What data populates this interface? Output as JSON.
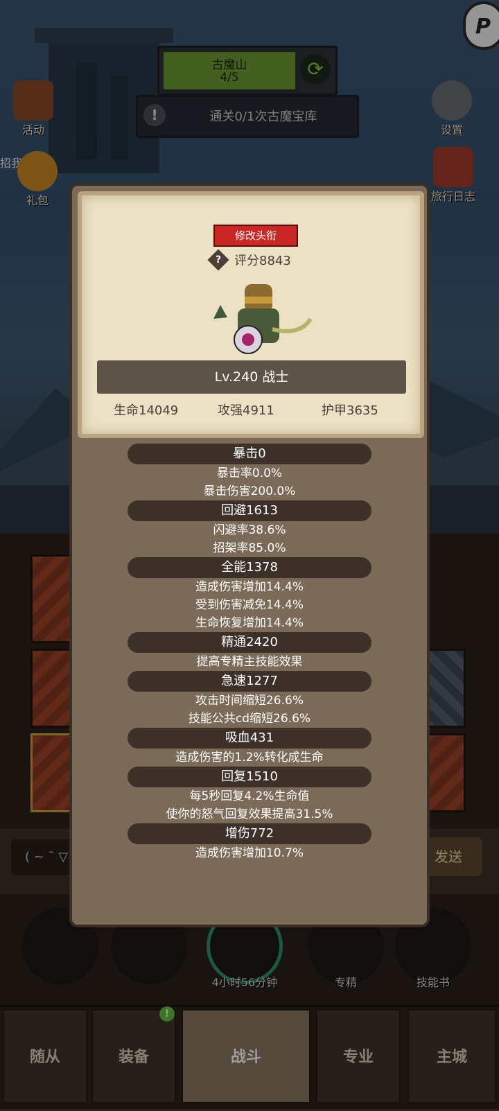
{
  "scene": {
    "dungeon": {
      "name": "古魔山",
      "progress": "4/5"
    },
    "quest": {
      "text": "通关0/1次古魔宝库"
    },
    "left_menu": [
      {
        "label": "活动"
      },
      {
        "label": "礼包"
      }
    ],
    "left_fragment": "招我g",
    "right_menu": [
      {
        "label": "设置"
      },
      {
        "label": "旅行日志"
      }
    ],
    "corner_letter": "P",
    "chat": {
      "input_text": "( ~ ¯ ▽",
      "send_label": "发送"
    },
    "skills": [
      {
        "label": ""
      },
      {
        "label": ""
      },
      {
        "label": "4小时56分钟"
      },
      {
        "label": "专精"
      },
      {
        "label": "技能书"
      }
    ],
    "nav": [
      {
        "label": "随从"
      },
      {
        "label": "装备"
      },
      {
        "label": "战斗"
      },
      {
        "label": "专业"
      },
      {
        "label": "主城"
      }
    ],
    "nav_badge": "!"
  },
  "modal": {
    "modify_title_label": "修改头衔",
    "score_label": "评分8843",
    "help_glyph": "?",
    "name_banner": "Lv.240 战士",
    "main_stats": [
      "生命14049",
      "攻强4911",
      "护甲3635"
    ],
    "stats": [
      {
        "header": "暴击0",
        "lines": [
          "暴击率0.0%",
          "暴击伤害200.0%"
        ]
      },
      {
        "header": "回避1613",
        "lines": [
          "闪避率38.6%",
          "招架率85.0%"
        ]
      },
      {
        "header": "全能1378",
        "lines": [
          "造成伤害增加14.4%",
          "受到伤害减免14.4%",
          "生命恢复增加14.4%"
        ]
      },
      {
        "header": "精通2420",
        "lines": [
          "提高专精主技能效果"
        ]
      },
      {
        "header": "急速1277",
        "lines": [
          "攻击时间缩短26.6%",
          "技能公共cd缩短26.6%"
        ]
      },
      {
        "header": "吸血431",
        "lines": [
          "造成伤害的1.2%转化成生命"
        ]
      },
      {
        "header": "回复1510",
        "lines": [
          "每5秒回复4.2%生命值",
          "使你的怒气回复效果提高31.5%"
        ]
      },
      {
        "header": "增伤772",
        "lines": [
          "造成伤害增加10.7%"
        ]
      }
    ]
  },
  "icons": {
    "refresh": "refresh-icon",
    "alert": "alert-icon",
    "help": "help-icon"
  },
  "colors": {
    "accent_red": "#c82726",
    "progress_green": "#6e9c36",
    "parchment": "#ece1c4",
    "panel_brown": "#7c6a59"
  }
}
